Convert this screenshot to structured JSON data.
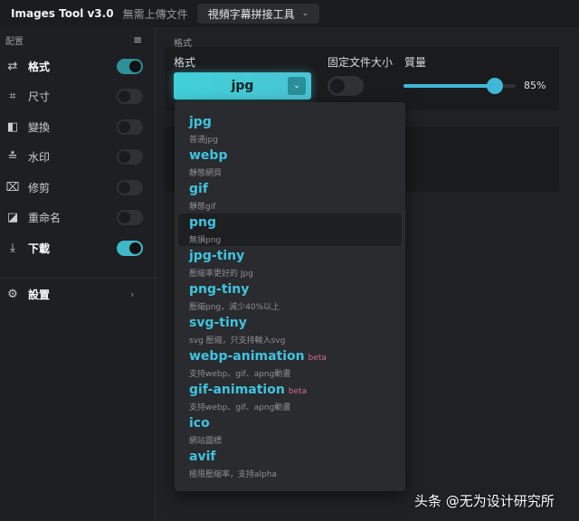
{
  "header": {
    "app_title": "Images Tool v3.0",
    "subtitle": "無需上傳文件",
    "tool_dropdown": "視頻字幕拼接工具"
  },
  "sidebar": {
    "section_label": "配置",
    "items": [
      {
        "label": "格式",
        "icon": "swap-icon",
        "enabled": true
      },
      {
        "label": "尺寸",
        "icon": "resize-icon",
        "enabled": false
      },
      {
        "label": "變換",
        "icon": "transform-icon",
        "enabled": false
      },
      {
        "label": "水印",
        "icon": "watermark-icon",
        "enabled": false
      },
      {
        "label": "修剪",
        "icon": "crop-icon",
        "enabled": false
      },
      {
        "label": "重命名",
        "icon": "rename-icon",
        "enabled": false
      },
      {
        "label": "下載",
        "icon": "download-icon",
        "enabled": true
      }
    ],
    "settings_label": "設置"
  },
  "main": {
    "section_label": "格式",
    "format_label": "格式",
    "format_value": "jpg",
    "fixed_size_label": "固定文件大小",
    "fixed_size_enabled": false,
    "quality_label": "質量",
    "quality_value": "85%",
    "quality_percent": 85
  },
  "format_menu": {
    "options": [
      {
        "name": "jpg",
        "desc": "普通jpg",
        "badge": ""
      },
      {
        "name": "webp",
        "desc": "靜態網頁",
        "badge": ""
      },
      {
        "name": "gif",
        "desc": "靜態gif",
        "badge": ""
      },
      {
        "name": "png",
        "desc": "無損png",
        "badge": ""
      },
      {
        "name": "jpg-tiny",
        "desc": "壓縮率更好的 Jpg",
        "badge": ""
      },
      {
        "name": "png-tiny",
        "desc": "壓縮png，減少40%以上",
        "badge": ""
      },
      {
        "name": "svg-tiny",
        "desc": "svg 壓縮，只支持輸入svg",
        "badge": ""
      },
      {
        "name": "webp-animation",
        "desc": "支持webp、gif、apng動畫",
        "badge": "beta"
      },
      {
        "name": "gif-animation",
        "desc": "支持webp、gif、apng動畫",
        "badge": "beta"
      },
      {
        "name": "ico",
        "desc": "網站圖標",
        "badge": ""
      },
      {
        "name": "avif",
        "desc": "極限壓縮率，支持alpha",
        "badge": ""
      }
    ],
    "hovered_index": 3
  },
  "watermark": "头条 @无为设计研究所",
  "colors": {
    "accent": "#3fc4e0",
    "toggle_on": "#3fb8c8",
    "beta": "#d06a8a"
  }
}
